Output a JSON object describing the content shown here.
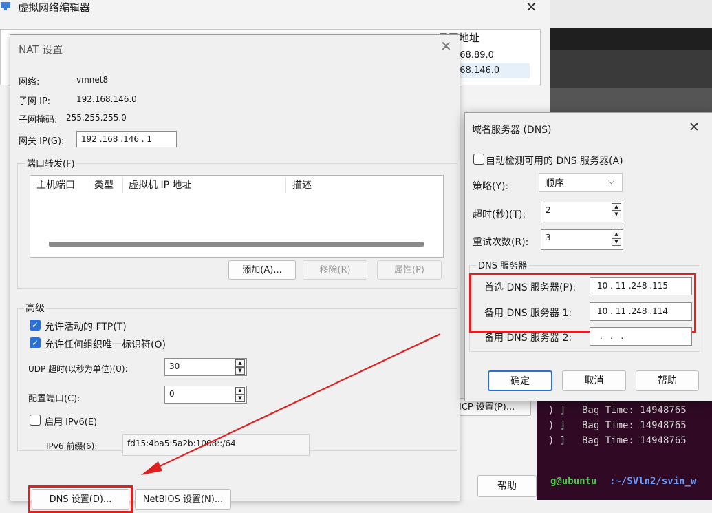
{
  "background_window": {
    "title": "虚拟网络编辑器",
    "close": "✕",
    "list": {
      "subnet_header": "子网地址",
      "rows": [
        "168.89.0",
        "168.146.0"
      ]
    },
    "dhcp_button": "ICP 设置(P)...",
    "help_button": "帮助"
  },
  "terminal": {
    "lines": [
      "Bag Time: 14948765",
      "Bag Time: 14948765",
      "Bag Time: 14948765"
    ],
    "prompt_user": "g@ubuntu",
    "prompt_path": ":~/SVln2/svin_w"
  },
  "nat_dialog": {
    "title": "NAT 设置",
    "close": "✕",
    "network_label": "网络:",
    "network_value": "vmnet8",
    "subnet_ip_label": "子网 IP:",
    "subnet_ip_value": "192.168.146.0",
    "subnet_mask_label": "子网掩码:",
    "subnet_mask_value": "255.255.255.0",
    "gateway_label": "网关 IP(G):",
    "gateway_value": "192 .168 .146 . 1",
    "port_forwarding": {
      "legend": "端口转发(F)",
      "headers": [
        "主机端口",
        "类型",
        "虚拟机 IP 地址",
        "描述"
      ],
      "add": "添加(A)...",
      "remove": "移除(R)",
      "properties": "属性(P)"
    },
    "advanced": {
      "legend": "高级",
      "allow_ftp": "允许活动的 FTP(T)",
      "allow_oui": "允许任何组织唯一标识符(O)",
      "udp_timeout_label": "UDP 超时(以秒为单位)(U):",
      "udp_timeout_value": "30",
      "config_port_label": "配置端口(C):",
      "config_port_value": "0",
      "enable_ipv6": "启用 IPv6(E)",
      "ipv6_prefix_label": "IPv6 前缀(6):",
      "ipv6_prefix_value": "fd15:4ba5:5a2b:1008::/64"
    },
    "dns_button": "DNS 设置(D)...",
    "netbios_button": "NetBIOS 设置(N)..."
  },
  "dns_dialog": {
    "title": "域名服务器 (DNS)",
    "close": "✕",
    "auto_detect": "自动检测可用的 DNS 服务器(A)",
    "policy_label": "策略(Y):",
    "policy_value": "顺序",
    "timeout_label": "超时(秒)(T):",
    "timeout_value": "2",
    "retries_label": "重试次数(R):",
    "retries_value": "3",
    "servers_legend": "DNS 服务器",
    "preferred_label": "首选 DNS 服务器(P):",
    "preferred_value": "10 . 11 .248 .115",
    "alternate1_label": "备用 DNS 服务器 1:",
    "alternate1_value": "10 . 11 .248 .114",
    "alternate2_label": "备用 DNS 服务器 2:",
    "alternate2_value": " .   .   . ",
    "ok": "确定",
    "cancel": "取消",
    "help": "帮助"
  },
  "colors": {
    "highlight": "#e02020",
    "accent": "#2a6fd6"
  }
}
